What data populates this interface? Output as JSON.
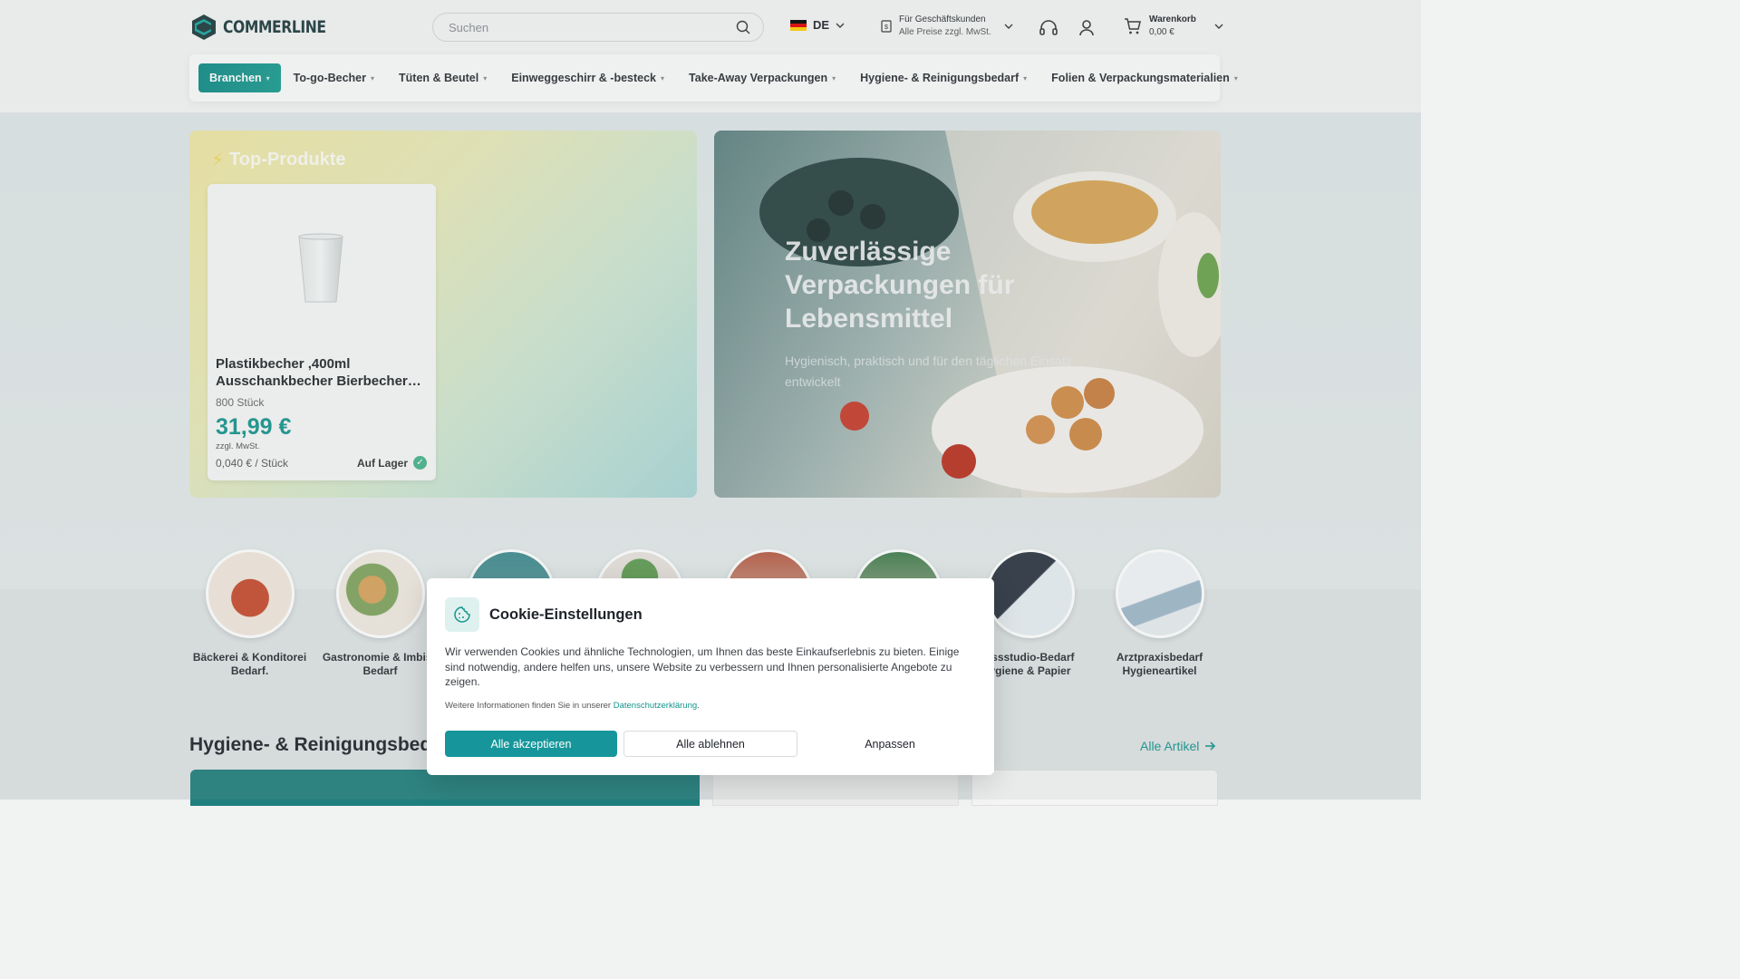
{
  "header": {
    "logo_text": "COMMERLINE",
    "search_placeholder": "Suchen",
    "lang": "DE",
    "business_line1": "Für Geschäftskunden",
    "business_line2": "Alle Preise zzgl. MwSt.",
    "cart_title": "Warenkorb",
    "cart_total": "0,00 €"
  },
  "nav": {
    "items": [
      {
        "label": "Branchen"
      },
      {
        "label": "To-go-Becher"
      },
      {
        "label": "Tüten & Beutel"
      },
      {
        "label": "Einweggeschirr & -besteck"
      },
      {
        "label": "Take-Away Verpackungen"
      },
      {
        "label": "Hygiene- & Reinigungsbedarf"
      },
      {
        "label": "Folien & Verpackungsmaterialien"
      }
    ]
  },
  "top_products": {
    "title": "Top-Produkte",
    "product": {
      "name": "Plastikbecher ,400ml Ausschankbecher Bierbecher…",
      "quantity": "800 Stück",
      "price": "31,99 €",
      "tax_note": "zzgl. MwSt.",
      "unit_price": "0,040 € / Stück",
      "stock": "Auf Lager"
    }
  },
  "hero": {
    "title": "Zuverlässige Verpackungen für Lebensmittel",
    "subtitle": "Hygienisch, praktisch und für den täglichen Einsatz entwickelt"
  },
  "categories": [
    {
      "line1": "Bäckerei & Konditorei",
      "line2": "Bedarf."
    },
    {
      "line1": "Gastronomie & Imbiss",
      "line2": "Bedarf"
    },
    {
      "line1": "",
      "line2": ""
    },
    {
      "line1": "",
      "line2": ""
    },
    {
      "line1": "",
      "line2": ""
    },
    {
      "line1": "",
      "line2": ""
    },
    {
      "line1": "essstudio-Bedarf",
      "line2": "ygiene & Papier"
    },
    {
      "line1": "Arztpraxisbedarf",
      "line2": "Hygieneartikel"
    }
  ],
  "section": {
    "title": "Hygiene- & Reinigungsbeda",
    "all_link": "Alle Artikel"
  },
  "cookie": {
    "title": "Cookie-Einstellungen",
    "text": "Wir verwenden Cookies und ähnliche Technologien, um Ihnen das beste Einkaufserlebnis zu bieten. Einige sind notwendig, andere helfen uns, unsere Website zu verbessern und Ihnen personalisierte Angebote zu zeigen.",
    "more_prefix": "Weitere Informationen finden Sie in unserer ",
    "more_link": "Datenschutzerklärung",
    "more_suffix": ".",
    "accept": "Alle akzeptieren",
    "reject": "Alle ablehnen",
    "customize": "Anpassen"
  },
  "colors": {
    "accent": "#16969a",
    "price": "#14948c",
    "stock_ok": "#47b38b"
  },
  "icons": [
    "search-icon",
    "chevron-down-icon",
    "tax-icon",
    "headset-icon",
    "user-icon",
    "cart-icon",
    "bolt-icon",
    "check-icon",
    "cookie-icon",
    "arrow-right-icon"
  ]
}
